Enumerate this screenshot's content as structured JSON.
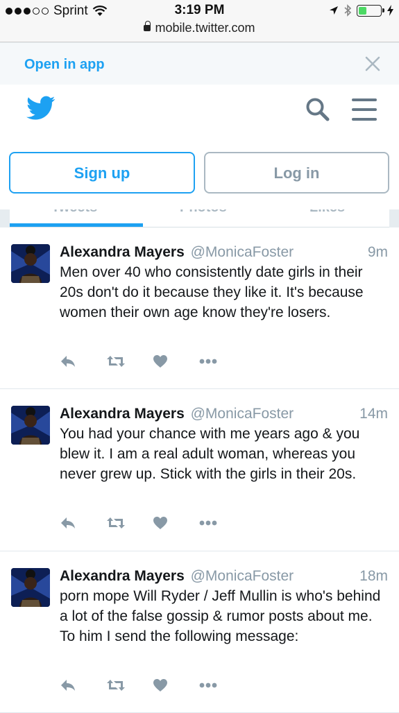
{
  "status_bar": {
    "carrier": "Sprint",
    "time": "3:19 PM",
    "colors": {
      "battery": "#4cd964"
    }
  },
  "browser": {
    "url": "mobile.twitter.com"
  },
  "app_banner": {
    "open_label": "Open in app"
  },
  "header": {
    "signup_label": "Sign up",
    "login_label": "Log in"
  },
  "tabs": [
    "Tweets",
    "Photos",
    "Likes"
  ],
  "colors": {
    "accent": "#1da1f2",
    "muted": "#8899a6",
    "icon": "#657786"
  },
  "tweets": [
    {
      "name": "Alexandra Mayers",
      "handle": "@MonicaFoster",
      "time": "9m",
      "text": "Men over 40 who consistently date girls in their 20s don't do it because they like it. It's because women their own age know they're losers."
    },
    {
      "name": "Alexandra Mayers",
      "handle": "@MonicaFoster",
      "time": "14m",
      "text": "You had your chance with me years ago & you blew it. I  am a real adult woman, whereas you never grew up. Stick with the girls in their 20s."
    },
    {
      "name": "Alexandra Mayers",
      "handle": "@MonicaFoster",
      "time": "18m",
      "text": "porn mope Will Ryder / Jeff Mullin is who's behind a lot of the false gossip & rumor posts about me. To him I send the following message:"
    }
  ]
}
